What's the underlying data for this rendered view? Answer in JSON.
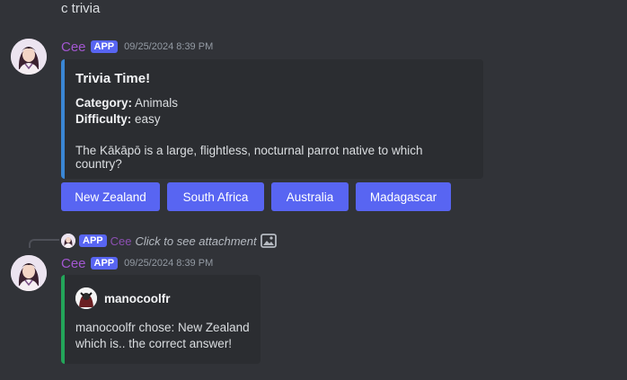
{
  "previous_message": {
    "text": "c trivia"
  },
  "message1": {
    "username": "Cee",
    "tag": "APP",
    "timestamp": "09/25/2024 8:39 PM",
    "embed": {
      "title": "Trivia Time!",
      "category_label": "Category:",
      "category_value": "Animals",
      "difficulty_label": "Difficulty:",
      "difficulty_value": "easy",
      "question": "The Kākāpō is a large, flightless, nocturnal parrot native to which country?",
      "accent_color": "#3a86d4"
    },
    "buttons": [
      "New Zealand",
      "South Africa",
      "Australia",
      "Madagascar"
    ]
  },
  "reply_preview": {
    "tag": "APP",
    "username": "Cee",
    "text": "Click to see attachment",
    "icon": "image-icon"
  },
  "message2": {
    "username": "Cee",
    "tag": "APP",
    "timestamp": "09/25/2024 8:39 PM",
    "embed": {
      "author": "manocoolfr",
      "description_line1": "manocoolfr chose: New Zealand",
      "description_line2": "which is.. the correct answer!",
      "accent_color": "#23a559"
    }
  },
  "colors": {
    "background": "#313338",
    "embed_bg": "#2b2d31",
    "button": "#5865f2",
    "username": "#a357d1"
  }
}
